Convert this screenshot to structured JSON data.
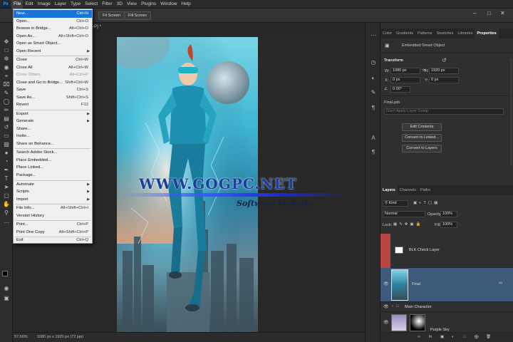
{
  "menubar": {
    "logo": "Ps",
    "items": [
      "File",
      "Edit",
      "Image",
      "Layer",
      "Type",
      "Select",
      "Filter",
      "3D",
      "View",
      "Plugins",
      "Window",
      "Help"
    ]
  },
  "options_bar": {
    "btn1": "Fit Screen",
    "btn2": "Fill Screen"
  },
  "document": {
    "tab_label": "‹P) *"
  },
  "status": {
    "zoom": "57.66%",
    "info": "1080 px x 1920 px (72 ppi)"
  },
  "watermark": {
    "main": "WWW.GOGPC.NET",
    "sub": "Software Website"
  },
  "file_menu": {
    "new": {
      "label": "New...",
      "shortcut": "Ctrl+N"
    },
    "open": {
      "label": "Open...",
      "shortcut": "Ctrl+O"
    },
    "browse": {
      "label": "Browse in Bridge...",
      "shortcut": "Alt+Ctrl+O"
    },
    "open_as": {
      "label": "Open As...",
      "shortcut": "Alt+Shift+Ctrl+O"
    },
    "open_smart": {
      "label": "Open as Smart Object..."
    },
    "open_recent": {
      "label": "Open Recent"
    },
    "close": {
      "label": "Close",
      "shortcut": "Ctrl+W"
    },
    "close_all": {
      "label": "Close All",
      "shortcut": "Alt+Ctrl+W"
    },
    "close_others": {
      "label": "Close Others",
      "shortcut": "Alt+Ctrl+P"
    },
    "close_bridge": {
      "label": "Close and Go to Bridge...",
      "shortcut": "Shift+Ctrl+W"
    },
    "save": {
      "label": "Save",
      "shortcut": "Ctrl+S"
    },
    "save_as": {
      "label": "Save As...",
      "shortcut": "Shift+Ctrl+S"
    },
    "revert": {
      "label": "Revert",
      "shortcut": "F12"
    },
    "export": {
      "label": "Export"
    },
    "generate": {
      "label": "Generate"
    },
    "share": {
      "label": "Share..."
    },
    "invite": {
      "label": "Invite..."
    },
    "share_behance": {
      "label": "Share on Behance..."
    },
    "search_stock": {
      "label": "Search Adobe Stock..."
    },
    "place_embedded": {
      "label": "Place Embedded..."
    },
    "place_linked": {
      "label": "Place Linked..."
    },
    "package": {
      "label": "Package..."
    },
    "automate": {
      "label": "Automate"
    },
    "scripts": {
      "label": "Scripts"
    },
    "import": {
      "label": "Import"
    },
    "file_info": {
      "label": "File Info...",
      "shortcut": "Alt+Shift+Ctrl+I"
    },
    "version_history": {
      "label": "Version History"
    },
    "print": {
      "label": "Print...",
      "shortcut": "Ctrl+P"
    },
    "print_one": {
      "label": "Print One Copy",
      "shortcut": "Alt+Shift+Ctrl+P"
    },
    "exit": {
      "label": "Exit",
      "shortcut": "Ctrl+Q"
    }
  },
  "properties_panel": {
    "tabs": [
      "Color",
      "Gradients",
      "Patterns",
      "Swatches",
      "Libraries",
      "Properties"
    ],
    "active_tab": "Properties",
    "object_type": "Embedded Smart Object",
    "transform_label": "Transform",
    "w_label": "W:",
    "w_value": "1080 px",
    "h_label": "H:",
    "h_value": "1920 px",
    "x_label": "X:",
    "x_value": "0 px",
    "y_label": "Y:",
    "y_value": "0 px",
    "angle_value": "0.00°",
    "file_name": "Final.psb",
    "layer_comp": "Don't Apply Layer Comp",
    "edit_contents": "Edit Contents",
    "convert_linked": "Convert to Linked...",
    "convert_layers": "Convert to Layers"
  },
  "layers_panel": {
    "tabs": [
      "Layers",
      "Channels",
      "Paths"
    ],
    "active_tab": "Layers",
    "kind": "Kind",
    "blend_mode": "Normal",
    "opacity_label": "Opacity:",
    "opacity": "100%",
    "lock_label": "Lock:",
    "fill_label": "Fill:",
    "fill": "100%",
    "layers": [
      {
        "name": "BLK Check Layer"
      },
      {
        "name": "Final"
      },
      {
        "name": "Main Character"
      },
      {
        "name": "Purple Sky"
      }
    ],
    "fx_label": "fx"
  },
  "colors": {
    "accent": "#1874d6",
    "brand": "#31a8ff",
    "highlight_layer": "#3d5a7a",
    "red_layer": "#b84444"
  }
}
